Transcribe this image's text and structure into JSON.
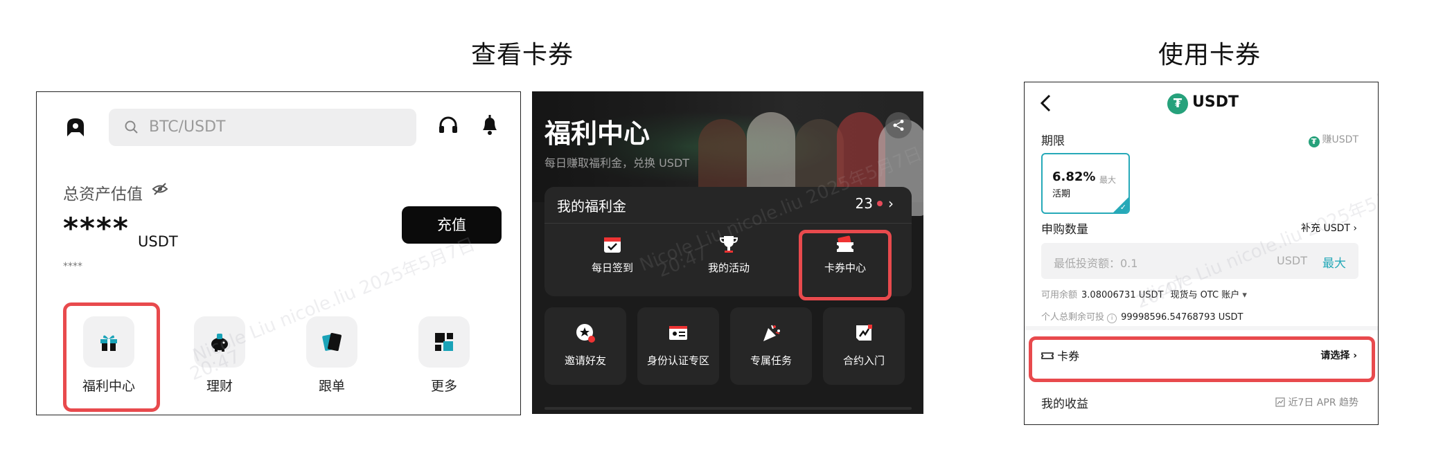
{
  "headings": {
    "view": "查看卡券",
    "use": "使用卡券"
  },
  "watermark": {
    "line1": "Nicole Liu nicole.liu 2025年5月7日",
    "line2": "20:47"
  },
  "panel1": {
    "search_placeholder": "BTC/USDT",
    "asset_label": "总资产估值",
    "masked_value": "****",
    "unit": "USDT",
    "masked_small": "****",
    "recharge": "充值",
    "tiles": [
      {
        "label": "福利中心",
        "icon": "gift-icon"
      },
      {
        "label": "理财",
        "icon": "piggy-bank-icon"
      },
      {
        "label": "跟单",
        "icon": "copy-trade-icon"
      },
      {
        "label": "更多",
        "icon": "more-grid-icon"
      }
    ],
    "highlight_color": "#e84a4d"
  },
  "panel2": {
    "title": "福利中心",
    "subtitle": "每日赚取福利金，兑换 USDT",
    "card_title": "我的福利金",
    "card_count": "23",
    "card_items": [
      {
        "label": "每日签到",
        "icon": "calendar-check-icon"
      },
      {
        "label": "我的活动",
        "icon": "trophy-icon"
      },
      {
        "label": "卡券中心",
        "icon": "coupon-icon"
      }
    ],
    "tiles": [
      {
        "label": "邀请好友",
        "icon": "invite-friends-icon"
      },
      {
        "label": "身份认证专区",
        "icon": "id-card-icon"
      },
      {
        "label": "专属任务",
        "icon": "party-popper-icon"
      },
      {
        "label": "合约入门",
        "icon": "chart-doc-icon"
      }
    ]
  },
  "panel3": {
    "token": "USDT",
    "term_label": "期限",
    "earn": "赚USDT",
    "rate": "6.82%",
    "rate_max": "最大",
    "term_type": "活期",
    "amount_label": "申购数量",
    "topup": "补充 USDT",
    "placeholder": "最低投资额：0.1",
    "input_unit": "USDT",
    "max": "最大",
    "available_label": "可用余额",
    "available_value": "3.08006731 USDT",
    "available_account": "现货与 OTC 账户",
    "remaining_label": "个人总剩余可投",
    "remaining_value": "99998596.54768793 USDT",
    "coupon_label": "卡券",
    "coupon_select": "请选择",
    "income_label": "我的收益",
    "trend": "近7日 APR 趋势",
    "accent": "#26a9b8",
    "tether_color": "#26a17b"
  }
}
